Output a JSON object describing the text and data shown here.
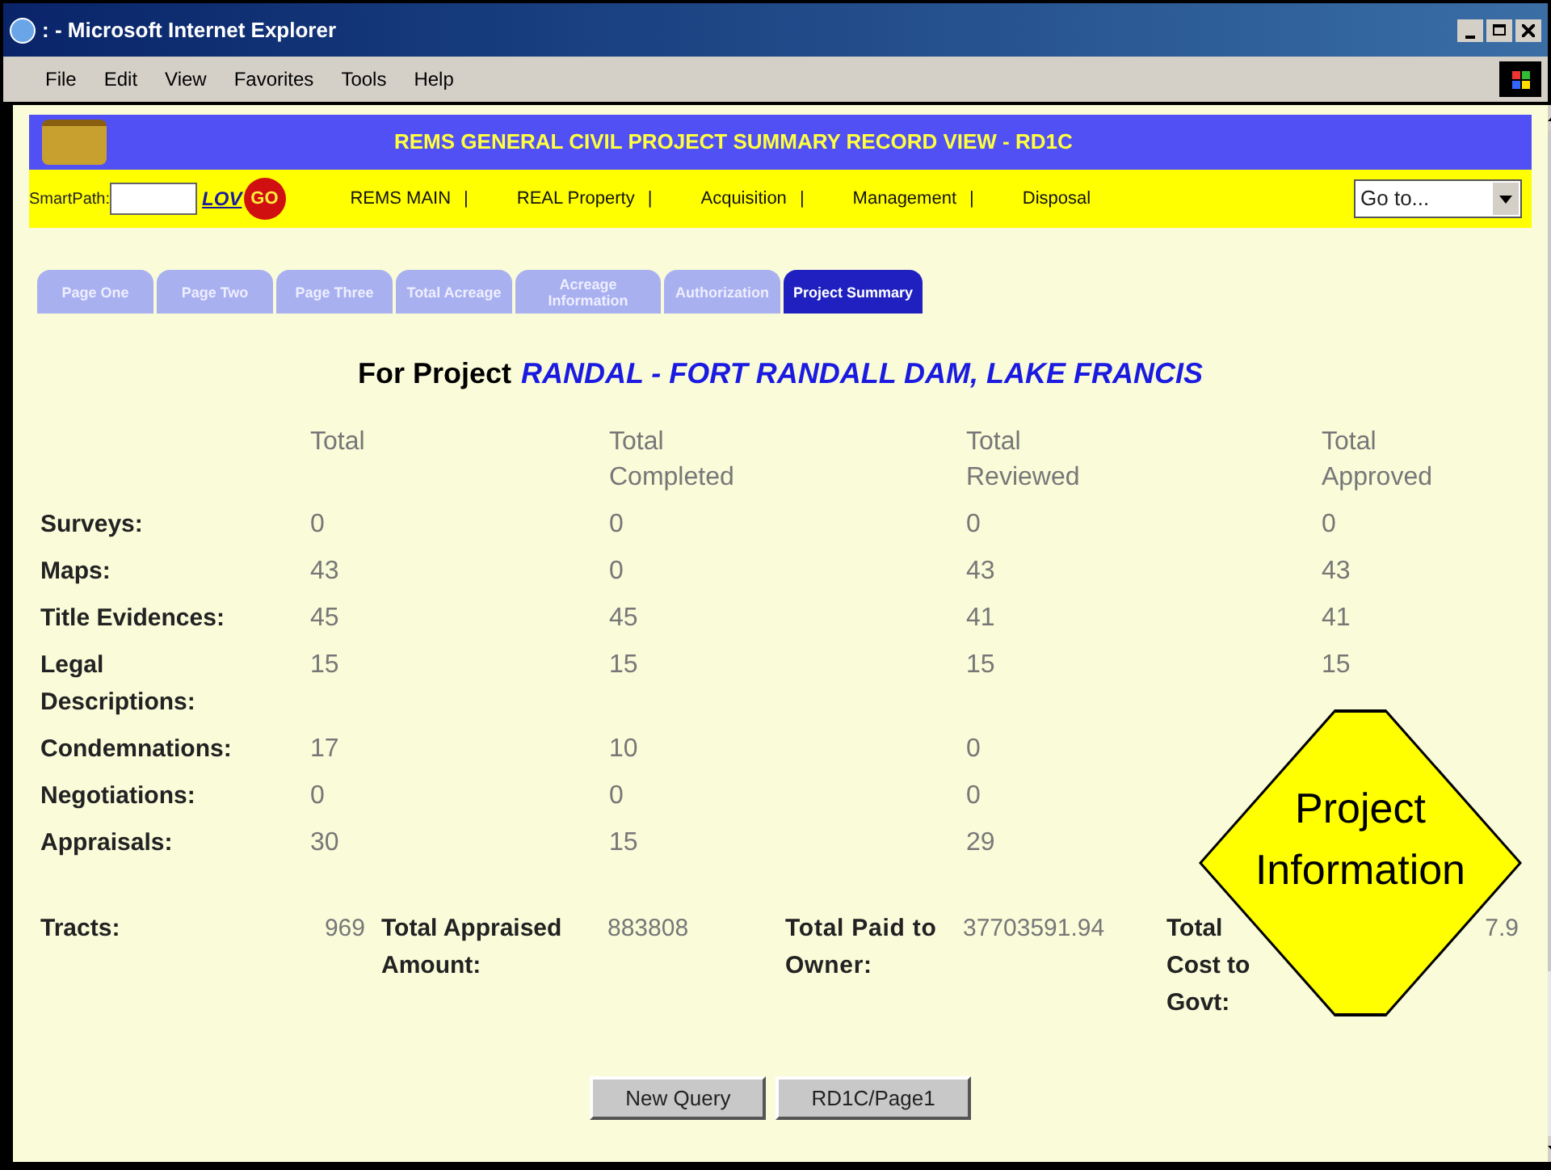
{
  "window": {
    "title": ": - Microsoft Internet Explorer"
  },
  "menu": [
    "File",
    "Edit",
    "View",
    "Favorites",
    "Tools",
    "Help"
  ],
  "banner": {
    "title": "REMS GENERAL CIVIL PROJECT SUMMARY RECORD VIEW - RD1C"
  },
  "smartpath": {
    "label": "SmartPath:",
    "lov": "LOV",
    "go": "GO"
  },
  "nav": [
    {
      "label": "REMS MAIN",
      "separator": "|"
    },
    {
      "label": "REAL Property",
      "separator": "|"
    },
    {
      "label": "Acquisition",
      "separator": "|"
    },
    {
      "label": "Management",
      "separator": "|"
    },
    {
      "label": "Disposal"
    }
  ],
  "goto": {
    "value": "Go to..."
  },
  "tabs": [
    {
      "label": "Page One",
      "selected": false
    },
    {
      "label": "Page Two",
      "selected": false
    },
    {
      "label": "Page Three",
      "selected": false
    },
    {
      "label": "Total Acreage",
      "selected": false
    },
    {
      "label": "Acreage Information",
      "selected": false
    },
    {
      "label": "Authorization",
      "selected": false
    },
    {
      "label": "Project Summary",
      "selected": true
    }
  ],
  "heading": {
    "prefix": "For Project",
    "project": "RANDAL - FORT RANDALL DAM, LAKE FRANCIS"
  },
  "table": {
    "columns": [
      "Total",
      "Total Completed",
      "Total Reviewed",
      "Total Approved"
    ],
    "rows": [
      {
        "label": "Surveys:",
        "values": [
          "0",
          "0",
          "0",
          "0"
        ]
      },
      {
        "label": "Maps:",
        "values": [
          "43",
          "0",
          "43",
          "43"
        ]
      },
      {
        "label": "Title Evidences:",
        "values": [
          "45",
          "45",
          "41",
          "41"
        ]
      },
      {
        "label": "Legal Descriptions:",
        "values": [
          "15",
          "15",
          "15",
          "15"
        ]
      },
      {
        "label": "Condemnations:",
        "values": [
          "17",
          "10",
          "0"
        ]
      },
      {
        "label": "Negotiations:",
        "values": [
          "0",
          "0",
          "0"
        ]
      },
      {
        "label": "Appraisals:",
        "values": [
          "30",
          "15",
          "29"
        ]
      }
    ]
  },
  "totals": {
    "tracts_label": "Tracts:",
    "tracts": "969",
    "appraised_label": "Total Appraised Amount:",
    "appraised": "883808",
    "paid_label": "Total Paid to Owner:",
    "paid": "37703591.94",
    "cost_label": "Total Cost to Govt:",
    "cost": "7.9"
  },
  "buttons": [
    "New Query",
    "RD1C/Page1"
  ],
  "callout": {
    "text": "Project Information"
  }
}
